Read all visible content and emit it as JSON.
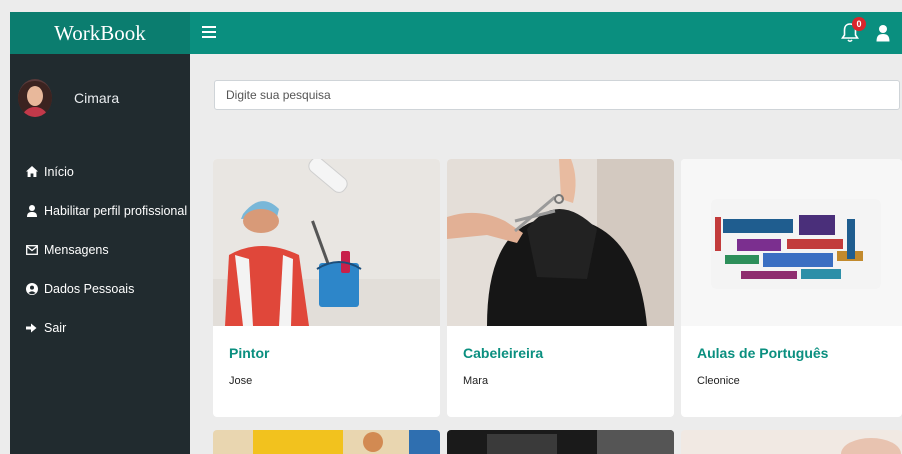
{
  "header": {
    "brand": "WorkBook",
    "notification_count": "0",
    "accent_color": "#0a8f7f"
  },
  "sidebar": {
    "user_name": "Cimara",
    "items": [
      {
        "icon": "home-icon",
        "label": "Início"
      },
      {
        "icon": "user-icon",
        "label": "Habilitar perfil profissional"
      },
      {
        "icon": "envelope-icon",
        "label": "Mensagens"
      },
      {
        "icon": "user-circle-icon",
        "label": "Dados Pessoais"
      },
      {
        "icon": "sign-out-icon",
        "label": "Sair"
      }
    ]
  },
  "search": {
    "placeholder": "Digite sua pesquisa"
  },
  "cards": [
    {
      "title": "Pintor",
      "subtitle": "Jose"
    },
    {
      "title": "Cabeleireira",
      "subtitle": "Mara"
    },
    {
      "title": "Aulas de Português",
      "subtitle": "Cleonice"
    }
  ]
}
